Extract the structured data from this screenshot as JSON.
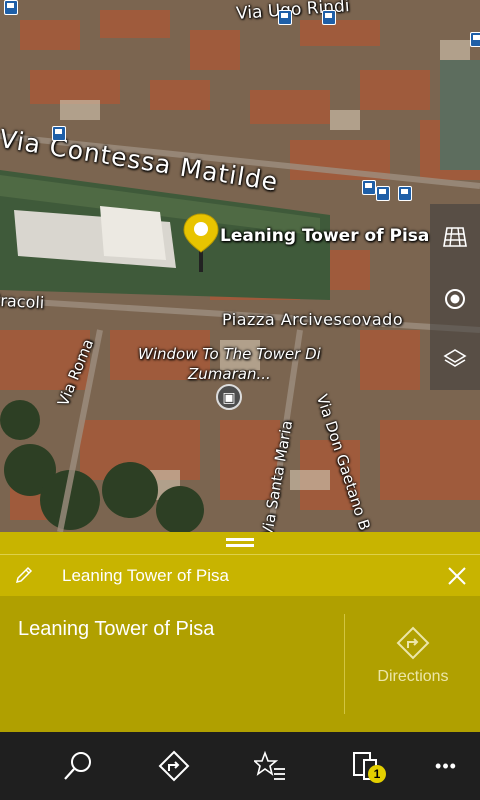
{
  "map": {
    "streets": {
      "contessa": "Via Contessa Matilde",
      "ughi": "Via Ugo Rindi",
      "miracoli": "iracoli",
      "roma": "Via Roma",
      "santa_maria": "Via Santa Maria",
      "gaetano": "Via Don Gaetano B"
    },
    "places": {
      "piazza": "Piazza Arcivescovado",
      "window_line1": "Window To The Tower Di",
      "window_line2": "Zumaran..."
    },
    "selected_poi": "Leaning Tower of Pisa",
    "tools": [
      "3d-buildings-icon",
      "locate-me-icon",
      "map-layers-icon"
    ]
  },
  "panel": {
    "title": "Leaning Tower of Pisa",
    "place_name": "Leaning Tower of Pisa",
    "directions_label": "Directions"
  },
  "appbar": {
    "buttons": [
      "search-icon",
      "directions-icon",
      "favorites-icon",
      "devices-icon",
      "more-icon"
    ],
    "badge_count": "1",
    "more_label": "•••"
  },
  "colors": {
    "accent": "#c8b400",
    "panel": "#b0a000",
    "appbar": "#1f1f1f",
    "pin": "#e8c400"
  }
}
